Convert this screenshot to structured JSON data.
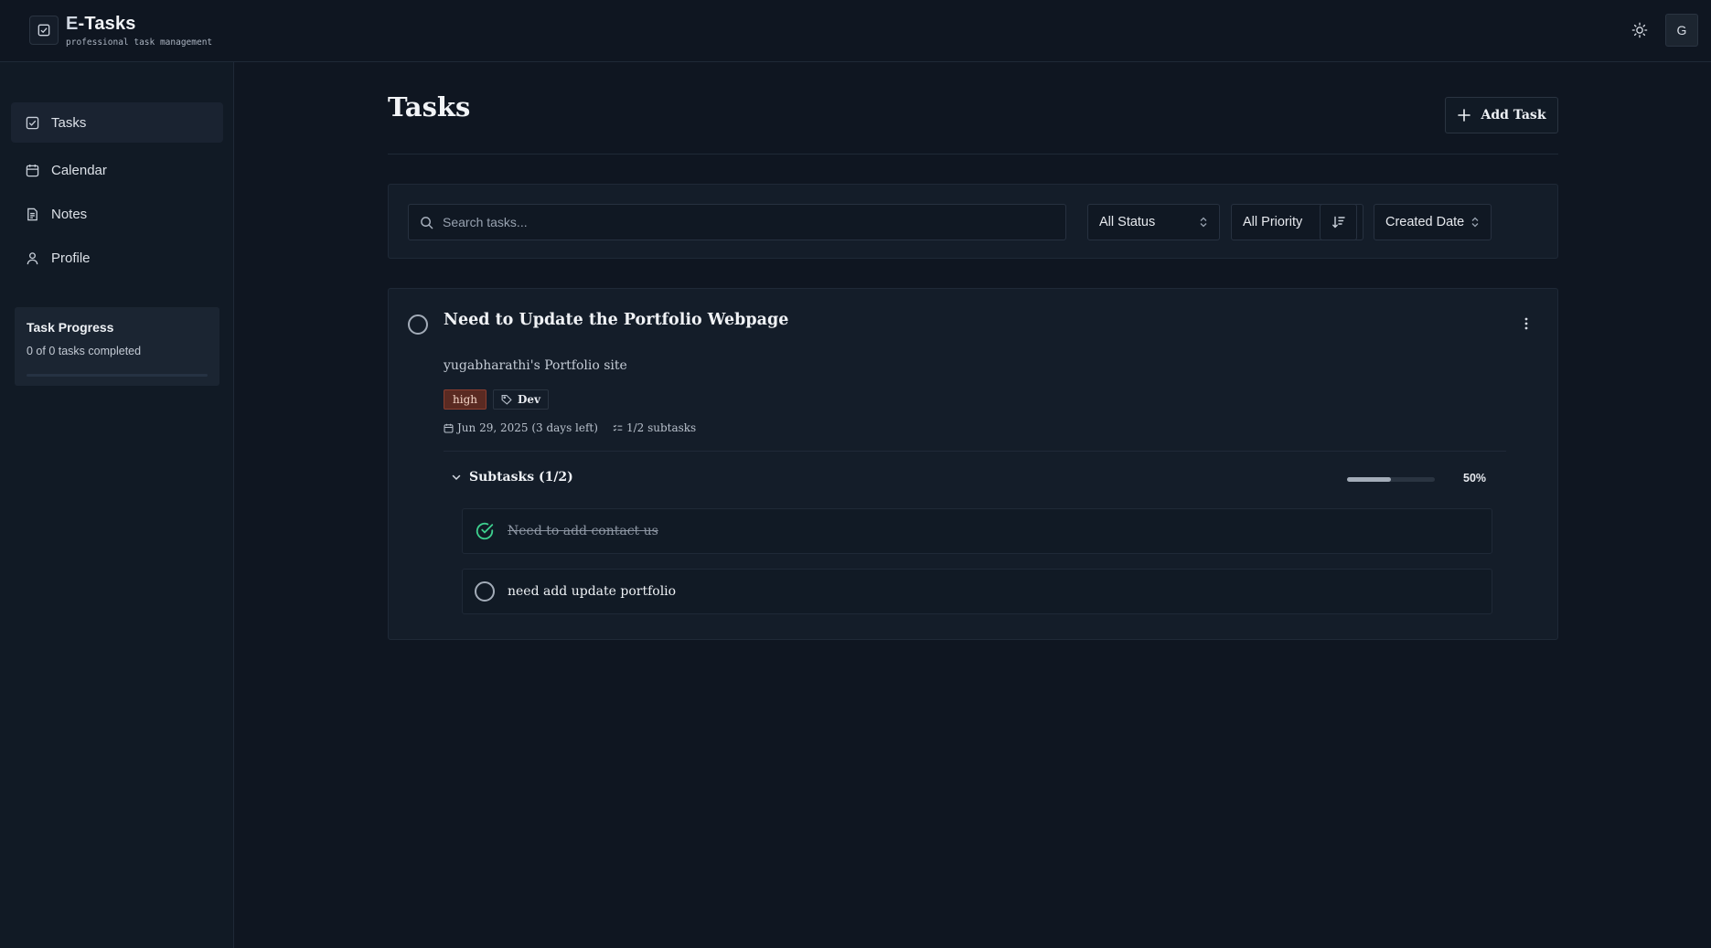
{
  "app": {
    "brand_initial": "E",
    "brand_rest": "-Tasks",
    "tagline": "professional task management",
    "avatar_letter": "G"
  },
  "sidebar": {
    "items": [
      {
        "label": "Tasks",
        "icon": "check-square-icon",
        "active": true
      },
      {
        "label": "Calendar",
        "icon": "calendar-icon",
        "active": false
      },
      {
        "label": "Notes",
        "icon": "file-text-icon",
        "active": false
      },
      {
        "label": "Profile",
        "icon": "user-icon",
        "active": false
      }
    ],
    "progress": {
      "title": "Task Progress",
      "summary": "0 of 0 tasks completed",
      "fraction": 0
    }
  },
  "main": {
    "title": "Tasks",
    "add_label": "Add Task",
    "search_placeholder": "Search tasks...",
    "filters": {
      "status": "All Status",
      "priority": "All Priority",
      "sort": "Created Date"
    }
  },
  "task": {
    "title": "Need to Update the Portfolio Webpage",
    "description": "yugabharathi's Portfolio site",
    "priority": "high",
    "tag": "Dev",
    "due": "Jun 29, 2025 (3 days left)",
    "subtask_count": "1/2 subtasks",
    "subtasks_header": "Subtasks (1/2)",
    "progress_label": "50%",
    "progress_fraction": 0.5,
    "subtasks": [
      {
        "label": "Need to add contact us",
        "done": true
      },
      {
        "label": "need add update portfolio",
        "done": false
      }
    ]
  },
  "colors": {
    "background": "#0f1621",
    "panel": "#141d29",
    "accent_done": "#3ecf8e",
    "priority_high": "#5a2a22"
  }
}
